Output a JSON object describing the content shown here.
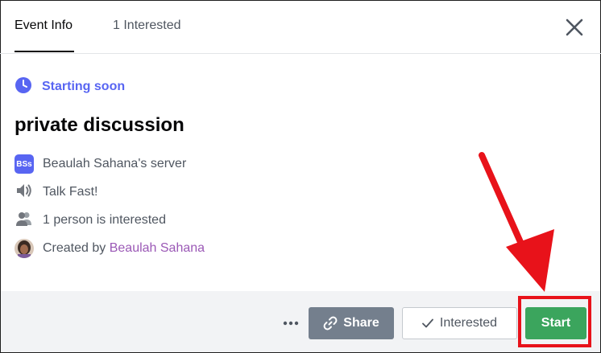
{
  "tabs": [
    {
      "label": "Event Info",
      "active": true
    },
    {
      "label": "1 Interested",
      "active": false
    }
  ],
  "status": {
    "text": "Starting soon",
    "icon": "clock-icon",
    "color": "#5865f2"
  },
  "event": {
    "title": "private discussion",
    "server": {
      "badge": "BSs",
      "name": "Beaulah Sahana's server"
    },
    "channel": {
      "icon": "speaker-icon",
      "name": "Talk Fast!"
    },
    "interest": {
      "icon": "people-icon",
      "text": "1 person is interested"
    },
    "creator": {
      "prefix": "Created by",
      "name": "Beaulah Sahana"
    }
  },
  "footer": {
    "more_icon": "ellipsis-icon",
    "share_label": "Share",
    "interested_label": "Interested",
    "start_label": "Start"
  },
  "colors": {
    "accent": "#5865f2",
    "start_button": "#3ba55d",
    "share_button": "#747f8d",
    "annotation": "#e8121a",
    "creator_link": "#9b59b6"
  }
}
